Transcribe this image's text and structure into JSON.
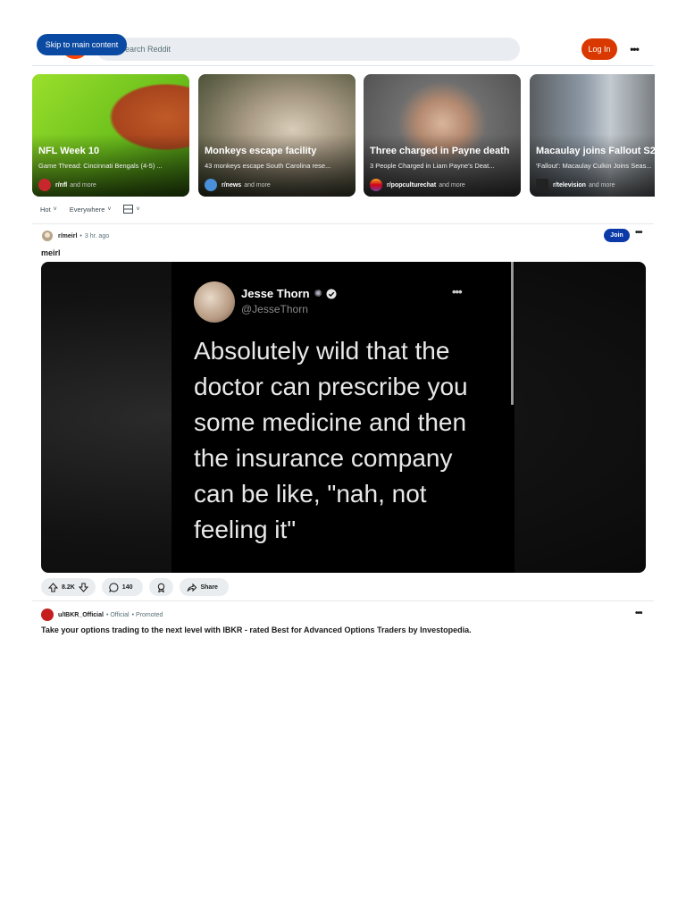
{
  "header": {
    "skip_link": "Skip to main content",
    "search_placeholder": "Search Reddit",
    "search_visible_text": "earch Reddit",
    "login_label": "Log In",
    "more_label": "•••"
  },
  "trending": [
    {
      "title": "NFL Week 10",
      "subtitle": "Game Thread: Cincinnati Bengals (4-5) ...",
      "subreddit": "r/nfl",
      "suffix": "and more",
      "icon": "nfl-logo-icon"
    },
    {
      "title": "Monkeys escape facility",
      "subtitle": "43 monkeys escape South Carolina rese...",
      "subreddit": "r/news",
      "suffix": "and more",
      "icon": "globe-icon"
    },
    {
      "title": "Three charged in Payne death",
      "subtitle": "3 People Charged in Liam Payne's Deat...",
      "subreddit": "r/popculturechat",
      "suffix": "and more",
      "icon": "sunset-icon"
    },
    {
      "title": "Macaulay joins Fallout S2",
      "subtitle": "'Fallout': Macaulay Culkin Joins Seas...",
      "subreddit": "r/television",
      "suffix": "and more",
      "icon": "tv-icon"
    }
  ],
  "sortbar": {
    "sort": "Hot",
    "location": "Everywhere",
    "view_icon": "layout-icon"
  },
  "post": {
    "subreddit": "r/meirl",
    "separator": "•",
    "time": "3 hr. ago",
    "join_label": "Join",
    "more_label": "•••",
    "title": "meirl",
    "tweet": {
      "name": "Jesse Thorn",
      "handle": "@JesseThorn",
      "more": "•••",
      "text": "Absolutely wild that the doctor can prescribe you some medicine and then the insurance company can be like, \"nah, not feeling it\""
    },
    "votes": "8.2K",
    "comments": "140",
    "share_label": "Share"
  },
  "promoted": {
    "user": "u/IBKR_Official",
    "official": "• Official",
    "promoted": "• Promoted",
    "more_label": "•••",
    "text": "Take your options trading to the next level with IBKR - rated Best for Advanced Options Traders by Investopedia."
  }
}
